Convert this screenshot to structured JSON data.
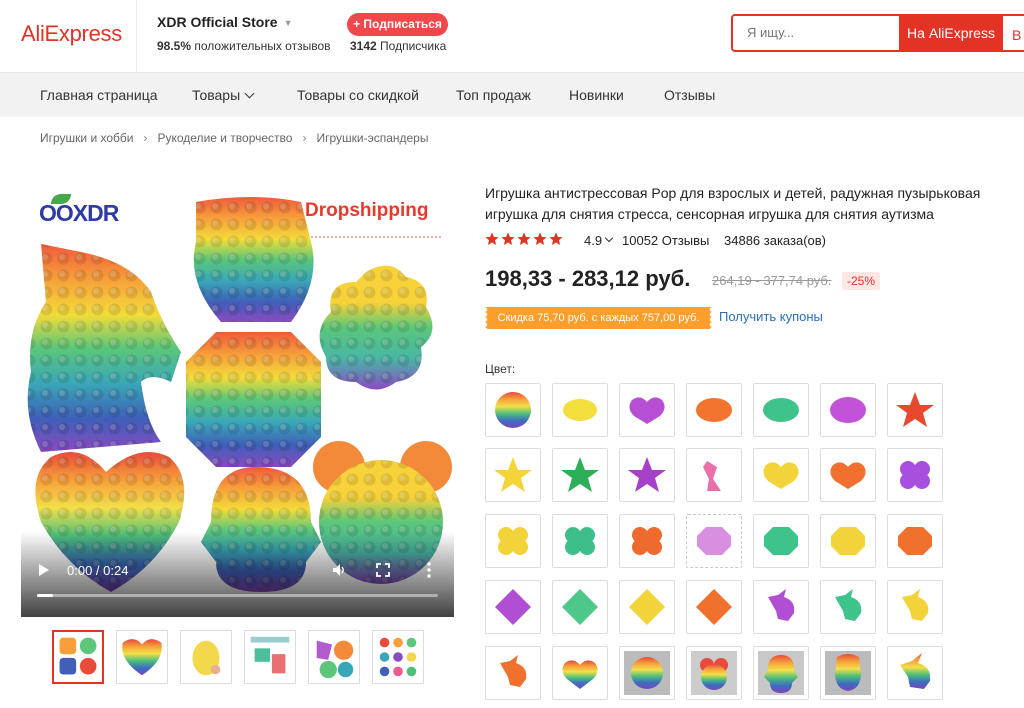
{
  "header": {
    "logo": "AliExpress",
    "store_name": "XDR Official Store",
    "positive_pct": "98.5%",
    "positive_text": "положительных отзывов",
    "subscribe_label": "+ Подписаться",
    "subscribers_count": "3142",
    "subscribers_text": "Подписчика",
    "search_placeholder": "Я ищу...",
    "search_button": "На AliExpress",
    "search_button2": "В с"
  },
  "nav": {
    "items": [
      "Главная страница",
      "Товары",
      "Товары со скидкой",
      "Топ продаж",
      "Новинки",
      "Отзывы"
    ]
  },
  "breadcrumb": [
    "Игрушки и хобби",
    "Рукоделие и творчество",
    "Игрушки-эспандеры"
  ],
  "media": {
    "brand_logo": "XDR",
    "watermark": "Dropshipping",
    "video_time": "0:00 / 0:24",
    "video_progress": 0.0
  },
  "product": {
    "title": "Игрушка антистрессовая Pop для взрослых и детей, радужная пузырьковая игрушка для снятия стресса, сенсорная игрушка для снятия аутизма",
    "rating": "4.9",
    "stars": 5,
    "reviews": "10052 Отзывы",
    "orders": "34886 заказа(ов)",
    "price": "198,33 - 283,12 руб.",
    "old_price": "264,19 - 377,74 руб.",
    "discount": "-25%",
    "coupon": "Скидка 75,70 руб. с каждых 757,00 руб.",
    "get_coupons": "Получить купоны",
    "color_label": "Цвет:"
  },
  "colors": {
    "accent": "#e43225",
    "link": "#2a6db5",
    "coupon": "#fc9e2c",
    "star": "#e43225"
  }
}
